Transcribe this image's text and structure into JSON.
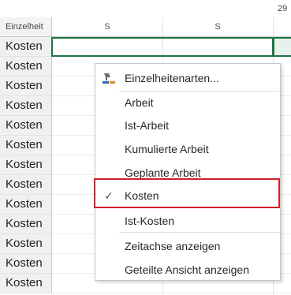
{
  "header": {
    "date_number": "29",
    "label_column": "Einzelheit",
    "days": [
      "S",
      "S"
    ]
  },
  "rows": [
    {
      "label": "Kosten"
    },
    {
      "label": "Kosten"
    },
    {
      "label": "Kosten"
    },
    {
      "label": "Kosten"
    },
    {
      "label": "Kosten"
    },
    {
      "label": "Kosten"
    },
    {
      "label": "Kosten"
    },
    {
      "label": "Kosten"
    },
    {
      "label": "Kosten"
    },
    {
      "label": "Kosten"
    },
    {
      "label": "Kosten"
    },
    {
      "label": "Kosten"
    },
    {
      "label": "Kosten"
    }
  ],
  "context_menu": {
    "details_styles": "Einzelheitenarten...",
    "items": [
      {
        "label": "Arbeit",
        "checked": false
      },
      {
        "label": "Ist-Arbeit",
        "checked": false
      },
      {
        "label": "Kumulierte Arbeit",
        "checked": false
      },
      {
        "label": "Geplante Arbeit",
        "checked": false
      },
      {
        "label": "Kosten",
        "checked": true
      },
      {
        "label": "Ist-Kosten",
        "checked": false
      }
    ],
    "show_timescale": "Zeitachse anzeigen",
    "show_split_view": "Geteilte Ansicht anzeigen",
    "check_icon": "check-icon",
    "details_icon": "paint-format-icon"
  },
  "colors": {
    "selection": "#217346",
    "highlight_box": "#d0202a"
  }
}
